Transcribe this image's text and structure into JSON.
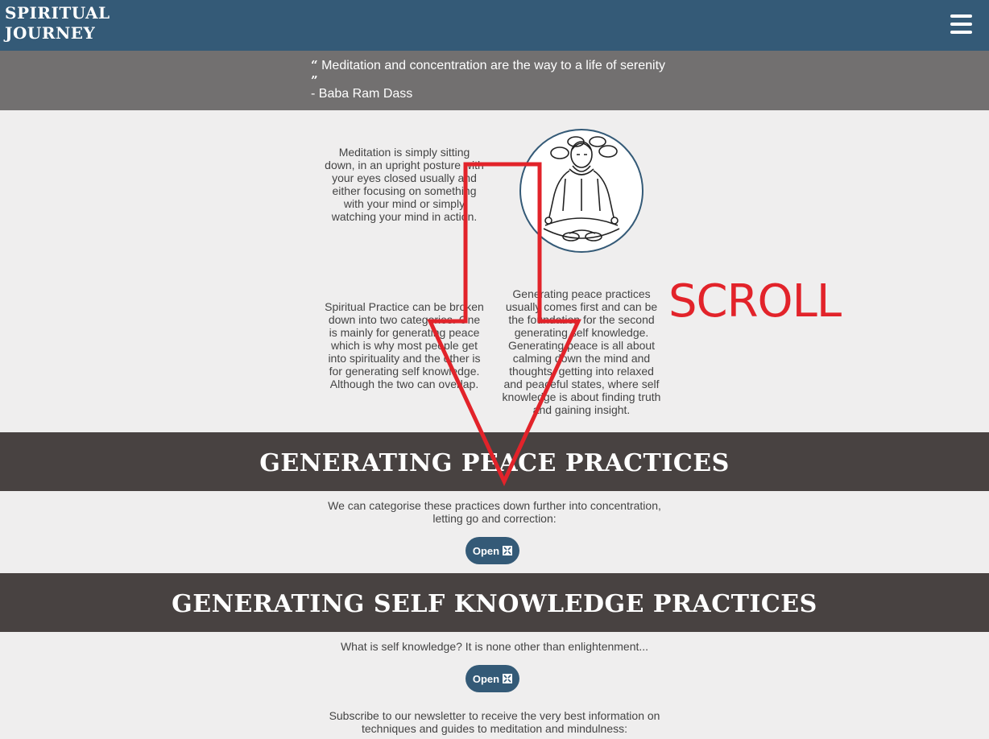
{
  "navbar": {
    "brand_line1": "SPIRITUAL",
    "brand_line2": "JOURNEY",
    "menu_icon": "hamburger-menu-icon",
    "color": "#345a77"
  },
  "quote": {
    "text": "Meditation and concentration are the way to a life of serenity",
    "author": "- Baba Ram Dass",
    "open_mark": "“",
    "close_mark": "”"
  },
  "intro": {
    "meditation_text": "Meditation is simply sitting down, in an upright posture with your eyes closed usually and either focusing on something with your mind or simply watching your mind in action.",
    "image_icon": "meditating-person-icon",
    "practice_text": "Spiritual Practice can be broken down into two categories. One is mainly for generating peace which is why most people get into spirituality and the other is for generating self knowledge. Although the two can overlap.",
    "peace_first_text": "Generating peace practices usually comes first and can be the foundation for the second generating self knowledge. Generating peace is all about calming down the mind and thoughts, getting into relaxed and peaceful states, where self knowledge is about finding truth and gaining insight."
  },
  "sections": [
    {
      "title": "GENERATING PEACE PRACTICES",
      "description": "We can categorise these practices down further into concentration, letting go and correction:",
      "button_label": "Open"
    },
    {
      "title": "GENERATING SELF KNOWLEDGE PRACTICES",
      "description": "What is self knowledge? It is none other than enlightenment...",
      "button_label": "Open"
    }
  ],
  "newsletter": {
    "text": "Subscribe to our newsletter to receive the very best information on techniques and guides to meditation and mindulness:"
  },
  "annotation": {
    "label": "SCROLL",
    "arrow_icon": "down-arrow-icon",
    "color": "#e2232a"
  }
}
